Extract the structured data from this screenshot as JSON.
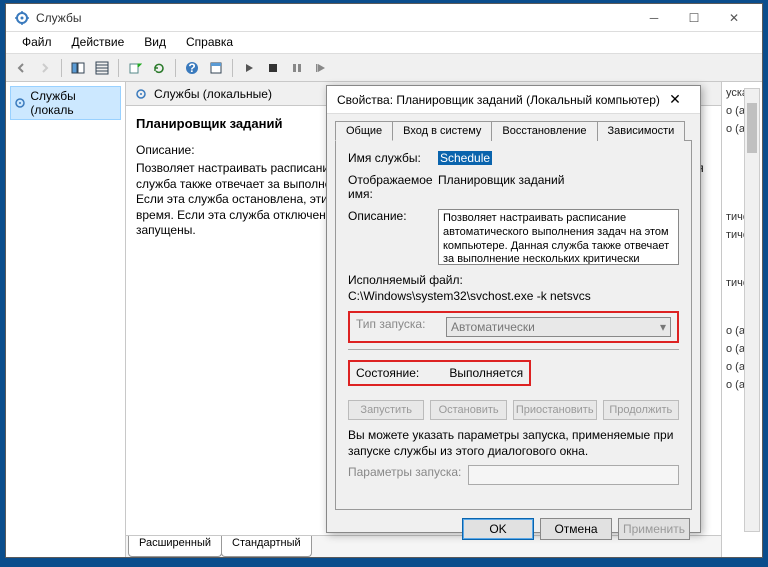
{
  "mainWindow": {
    "title": "Службы",
    "menu": {
      "file": "Файл",
      "action": "Действие",
      "view": "Вид",
      "help": "Справка"
    },
    "leftPane": {
      "item": "Службы (локаль"
    },
    "midHeader": "Службы (локальные)",
    "serviceTitle": "Планировщик заданий",
    "descLabel": "Описание:",
    "descText": "Позволяет настраивать расписание автоматического выполнения задач на этом компьютере. Данная служба также отвечает за выполнение нескольких критически важных системных задач Windows. Если эта служба остановлена, эти задачи не могут быть запущены в установленное расписанием время. Если эта служба отключена, любые службы, которые явно зависят от нее, не могут быть запущены.",
    "footerTabs": {
      "extended": "Расширенный",
      "standard": "Стандартный"
    },
    "rightItems": [
      "уска",
      "о (ак...",
      "о (ак...",
      "",
      "",
      "тиче...",
      "тиче...",
      "",
      "тиче...",
      "",
      "о (ак...",
      "о (ак...",
      "о (ак...",
      "о (ак..."
    ]
  },
  "dialog": {
    "title": "Свойства: Планировщик заданий (Локальный компьютер)",
    "tabs": {
      "general": "Общие",
      "logon": "Вход в систему",
      "recovery": "Восстановление",
      "deps": "Зависимости"
    },
    "labels": {
      "svcName": "Имя службы:",
      "dispName": "Отображаемое имя:",
      "desc": "Описание:",
      "exe": "Исполняемый файл:",
      "startType": "Тип запуска:",
      "status": "Состояние:",
      "startParams": "Параметры запуска:"
    },
    "values": {
      "svcName": "Schedule",
      "dispName": "Планировщик заданий",
      "desc": "Позволяет настраивать расписание автоматического выполнения задач на этом компьютере. Данная служба также отвечает за выполнение нескольких критически важных",
      "exe": "C:\\Windows\\system32\\svchost.exe -k netsvcs",
      "startType": "Автоматически",
      "status": "Выполняется"
    },
    "hint": "Вы можете указать параметры запуска, применяемые при запуске службы из этого диалогового окна.",
    "actionBtns": {
      "start": "Запустить",
      "stop": "Остановить",
      "pause": "Приостановить",
      "resume": "Продолжить"
    },
    "footerBtns": {
      "ok": "OK",
      "cancel": "Отмена",
      "apply": "Применить"
    }
  }
}
